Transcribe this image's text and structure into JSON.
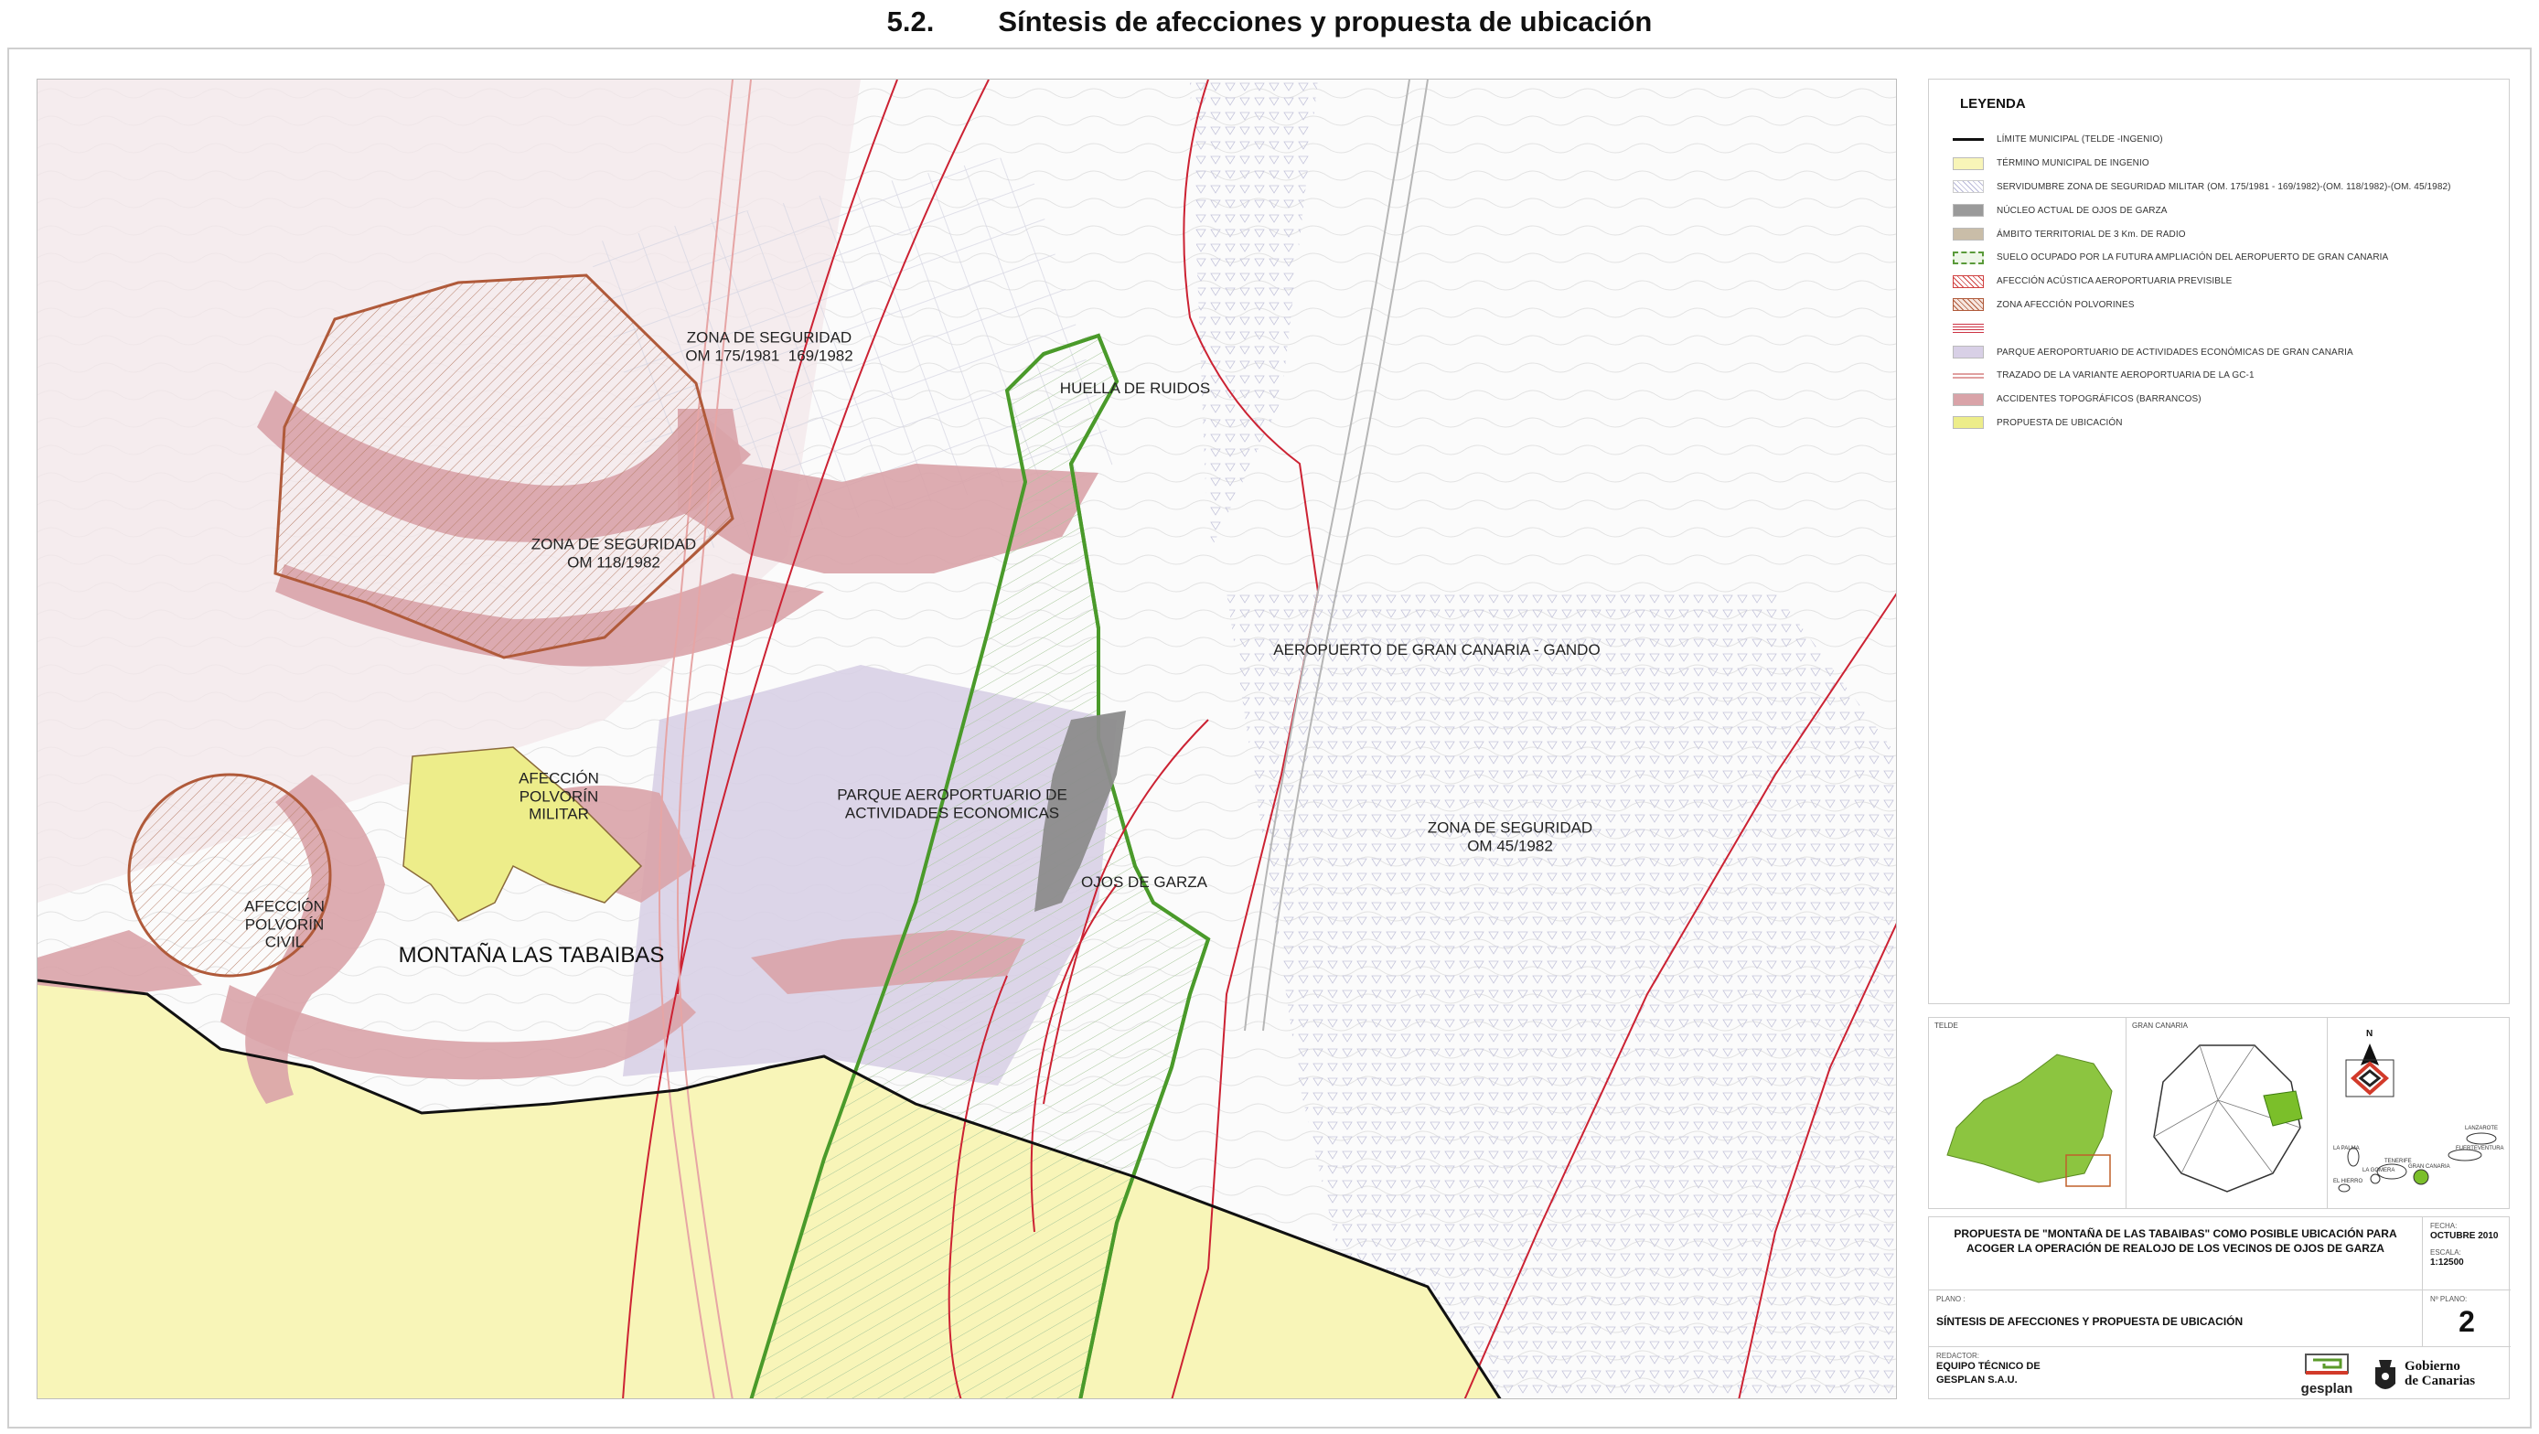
{
  "header": {
    "section_number": "5.2.",
    "section_title": "Síntesis de afecciones y propuesta de ubicación"
  },
  "map": {
    "labels": {
      "zona_seguridad_1": "ZONA DE SEGURIDAD\nOM 175/1981  169/1982",
      "huella_ruidos": "HUELLA DE RUIDOS",
      "zona_seguridad_2": "ZONA DE SEGURIDAD\nOM 118/1982",
      "aeropuerto": "AEROPUERTO DE GRAN CANARIA - GANDO",
      "afeccion_militar": "AFECCIÓN\nPOLVORÍN\nMILITAR",
      "parque": "PARQUE AEROPORTUARIO DE\nACTIVIDADES ECONOMICAS",
      "zona_seguridad_3": "ZONA DE SEGURIDAD\nOM 45/1982",
      "afeccion_civil": "AFECCIÓN\nPOLVORÍN\nCIVIL",
      "ojos_garza": "OJOS DE GARZA",
      "montana": "MONTAÑA LAS TABAIBAS"
    }
  },
  "legend": {
    "title": "LEYENDA",
    "items": [
      {
        "label": "LÍMITE MUNICIPAL (TELDE -INGENIO)",
        "swatch": "line",
        "color": "#111111"
      },
      {
        "label": "TÉRMINO  MUNICIPAL DE INGENIO",
        "swatch": "fill",
        "color": "#f8f5b8"
      },
      {
        "label": "SERVIDUMBRE ZONA DE SEGURIDAD MILITAR  (OM. 175/1981 - 169/1982)-(OM. 118/1982)-(OM. 45/1982)",
        "swatch": "dots",
        "color": "#b8b8d8"
      },
      {
        "label": "NÚCLEO ACTUAL DE OJOS DE GARZA",
        "swatch": "fill",
        "color": "#9a9a9a"
      },
      {
        "label": "ÁMBITO TERRITORIAL DE 3 Km. DE RADIO",
        "swatch": "fill",
        "color": "#c9bda8"
      },
      {
        "label": "SUELO OCUPADO POR LA FUTURA AMPLIACIÓN DEL AEROPUERTO DE GRAN CANARIA",
        "swatch": "dashed-green",
        "color": "#5a9a3a"
      },
      {
        "label": "AFECCIÓN ACÚSTICA AEROPORTUARIA PREVISIBLE",
        "swatch": "hatch",
        "color": "#d04040"
      },
      {
        "label": "ZONA AFECCIÓN POLVORINES",
        "swatch": "hatch-brown",
        "color": "#b05a3a"
      },
      {
        "label": "",
        "swatch": "lines",
        "color": "#cc3344"
      },
      {
        "label": "PARQUE AEROPORTUARIO DE ACTIVIDADES ECONÓMICAS DE GRAN CANARIA",
        "swatch": "fill",
        "color": "#d8d0e6"
      },
      {
        "label": "TRAZADO DE LA VARIANTE AEROPORTUARIA DE LA GC-1",
        "swatch": "double-line",
        "color": "#e0a0a0"
      },
      {
        "label": "ACCIDENTES TOPOGRÁFICOS (BARRANCOS)",
        "swatch": "fill",
        "color": "#d9a3a8"
      },
      {
        "label": "PROPUESTA DE UBICACIÓN",
        "swatch": "fill",
        "color": "#eded8a"
      }
    ]
  },
  "locators": {
    "telde": "TELDE",
    "gran_canaria": "GRAN CANARIA",
    "north": "N",
    "islands": [
      "LANZAROTE",
      "FUERTEVENTURA",
      "LA PALMA",
      "TENERIFE",
      "LA GOMERA",
      "GRAN CANARIA",
      "EL HIERRO"
    ]
  },
  "title_block": {
    "proposal": "PROPUESTA DE \"MONTAÑA DE LAS TABAIBAS\" COMO POSIBLE UBICACIÓN PARA ACOGER LA OPERACIÓN DE REALOJO DE LOS VECINOS DE OJOS DE GARZA",
    "fecha_label": "FECHA:",
    "fecha": "OCTUBRE  2010",
    "escala_label": "ESCALA:",
    "escala": "1:12500",
    "plano_label": "PLANO :",
    "plano_title": "SÍNTESIS DE AFECCIONES Y PROPUESTA DE UBICACIÓN",
    "nplano_label": "Nº PLANO:",
    "nplano": "2",
    "redactor_label": "REDACTOR:",
    "redactor": "EQUIPO TÉCNICO DE\nGESPLAN S.A.U.",
    "gesplan": "gesplan",
    "gobierno_1": "Gobierno",
    "gobierno_2": "de Canarias"
  },
  "colors": {
    "ingenio": "#f8f5b8",
    "barranco": "#d9a3a8",
    "polvorin": "#b05a3a",
    "green_zone": "#4a9a2a",
    "acoustic": "#cc2233",
    "parque": "#d8d0e6",
    "ojos": "#8c8c8c",
    "propuesta": "#eded8a",
    "municipal": "#111111"
  }
}
